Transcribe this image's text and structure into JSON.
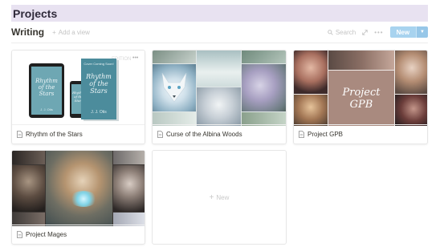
{
  "page": {
    "title": "Projects"
  },
  "view": {
    "name": "Writing",
    "add_view_label": "Add a view",
    "search_label": "Search",
    "new_label": "New"
  },
  "cards": [
    {
      "title": "Rhythm of the Stars",
      "book_title": "Rhythm of the Stars",
      "author": "J. J. Otis",
      "ebook_banner": "Cover Coming Soon!",
      "ribbon": "EDITION"
    },
    {
      "title": "Curse of the Albina Woods"
    },
    {
      "title": "Project GPB",
      "cover_text": "Project GPB"
    },
    {
      "title": "Project Mages"
    }
  ],
  "new_card_label": "New",
  "colors": {
    "title_bg": "#e8e2f1",
    "new_button": "#a8d3ef",
    "book_teal": "#4c8c9c"
  }
}
